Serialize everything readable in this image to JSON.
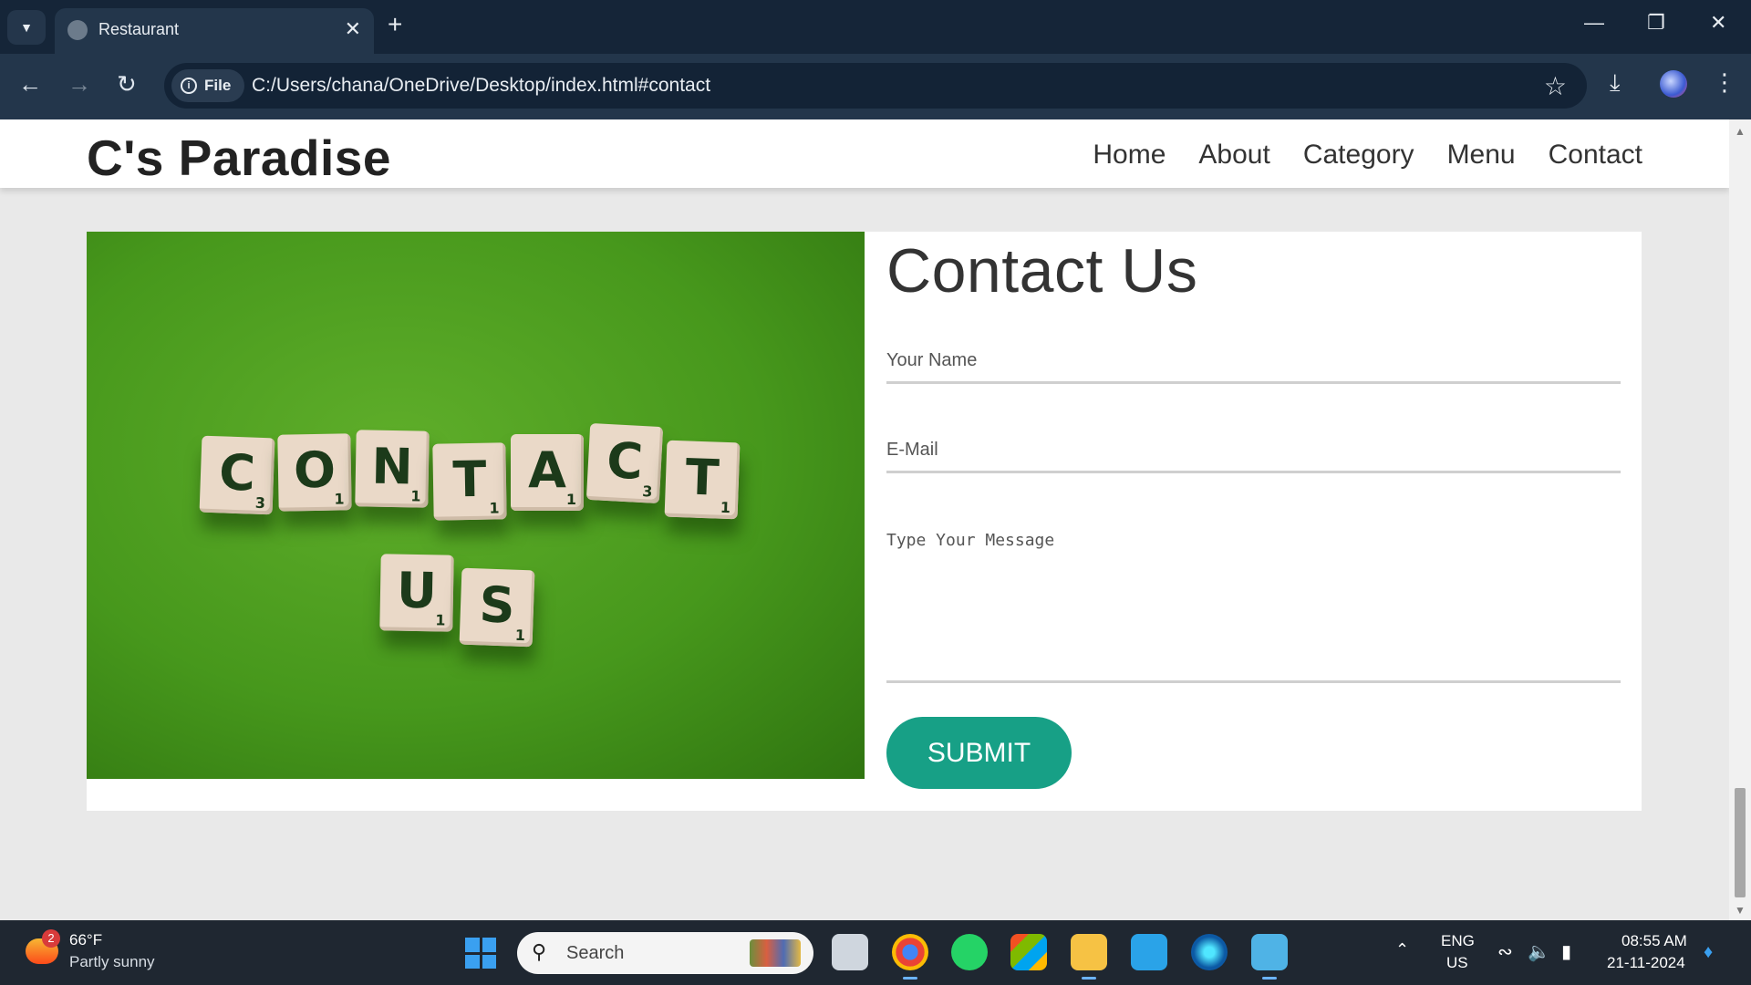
{
  "browser": {
    "tab_title": "Restaurant",
    "address_chip": "File",
    "url": "C:/Users/chana/OneDrive/Desktop/index.html#contact"
  },
  "site": {
    "logo": "C's Paradise",
    "nav": [
      {
        "label": "Home"
      },
      {
        "label": "About"
      },
      {
        "label": "Category"
      },
      {
        "label": "Menu"
      },
      {
        "label": "Contact"
      }
    ]
  },
  "contact": {
    "heading": "Contact Us",
    "name_placeholder": "Your Name",
    "email_placeholder": "E-Mail",
    "message_placeholder": "Type Your Message",
    "submit_label": "SUBMIT",
    "image_tiles": [
      {
        "letter": "C",
        "score": "3"
      },
      {
        "letter": "O",
        "score": "1"
      },
      {
        "letter": "N",
        "score": "1"
      },
      {
        "letter": "T",
        "score": "1"
      },
      {
        "letter": "A",
        "score": "1"
      },
      {
        "letter": "C",
        "score": "3"
      },
      {
        "letter": "T",
        "score": "1"
      },
      {
        "letter": "U",
        "score": "1"
      },
      {
        "letter": "S",
        "score": "1"
      }
    ]
  },
  "taskbar": {
    "weather_temp": "66°F",
    "weather_condition": "Partly sunny",
    "weather_badge": "2",
    "search_label": "Search",
    "language": "ENG",
    "region": "US",
    "time": "08:55 AM",
    "date": "21-11-2024"
  },
  "colors": {
    "accent_button": "#17a086",
    "browser_frame": "#152538"
  }
}
